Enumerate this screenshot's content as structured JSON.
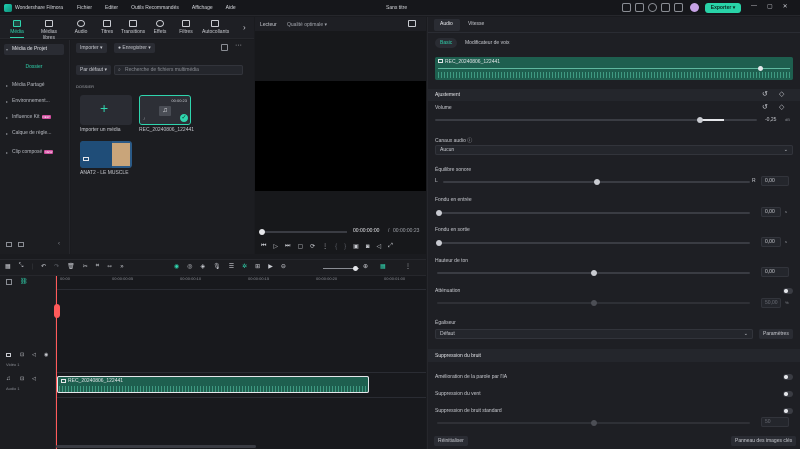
{
  "app": {
    "name": "Wondershare Filmora",
    "menu": [
      "Fichier",
      "Editer",
      "Outils Recommandés",
      "Affichage",
      "Aide"
    ],
    "document_title": "Sans titre",
    "export_label": "Exporter"
  },
  "left_tabs": [
    {
      "label": "Média",
      "icon": "media-icon"
    },
    {
      "label": "Médias libres",
      "icon": "stock-media-icon"
    },
    {
      "label": "Audio",
      "icon": "audio-icon"
    },
    {
      "label": "Titres",
      "icon": "titles-icon"
    },
    {
      "label": "Transitions",
      "icon": "transitions-icon"
    },
    {
      "label": "Effets",
      "icon": "effects-icon"
    },
    {
      "label": "Filtres",
      "icon": "filters-icon"
    },
    {
      "label": "Autocollants",
      "icon": "stickers-icon"
    }
  ],
  "sidebar": {
    "items": [
      {
        "label": "Média de Projet"
      },
      {
        "label": "Dossier"
      },
      {
        "label": "Média Partagé"
      },
      {
        "label": "Environnement..."
      },
      {
        "label": "Influence Kit",
        "badge": "NEW"
      },
      {
        "label": "Calque de règle..."
      },
      {
        "label": "Clip composé",
        "badge": "NEW"
      }
    ]
  },
  "media": {
    "import_label": "Importer",
    "record_label": "Enregistrer",
    "sort_label": "Par défaut",
    "search_placeholder": "Recherche de fichiers multimédia",
    "folder_label": "DOSSIER",
    "items": [
      {
        "label": "Importer un média",
        "type": "import"
      },
      {
        "label": "REC_20240806_122441",
        "type": "audio",
        "duration": "00:00:23",
        "selected": true
      },
      {
        "label": "ANAT2 - LE MUSCLE",
        "type": "video"
      }
    ]
  },
  "player": {
    "tab": "Lecteur",
    "quality": "Qualité optimale",
    "time_current": "00:00:00:00",
    "time_total": "00:00:00:23"
  },
  "right_panel": {
    "tabs": [
      "Audio",
      "Vitesse"
    ],
    "subtabs": [
      "Basic",
      "Modificateur de voix"
    ],
    "clip_name": "REC_20240806_122441",
    "section_adjust": "Ajustement",
    "volume_label": "Volume",
    "volume_value": "-0,25",
    "volume_unit": "dB",
    "audio_channel_label": "Canaux audio",
    "audio_channel_value": "Aucun",
    "balance_label": "Équilibre sonore",
    "balance_left": "L",
    "balance_right": "R",
    "balance_value": "0,00",
    "fade_in_label": "Fondu en entrée",
    "fade_in_value": "0,00",
    "fade_in_unit": "s",
    "fade_out_label": "Fondu en sortie",
    "fade_out_value": "0,00",
    "fade_out_unit": "s",
    "pitch_label": "Hauteur de ton",
    "pitch_value": "0,00",
    "ducking_label": "Atténuation",
    "ducking_value": "50,00",
    "ducking_unit": "%",
    "equalizer_label": "Égaliseur",
    "equalizer_value": "Défaut",
    "equalizer_settings": "Paramètres",
    "denoise_section": "Suppression du bruit",
    "denoise_items": [
      "Amélioration de la parole par l'IA",
      "Suppression du vent",
      "Suppression de bruit standard"
    ],
    "denoise_value": "50",
    "reset_label": "Réinitialiser",
    "keyframe_label": "Panneau des images clés"
  },
  "timeline": {
    "ruler": [
      "00:00",
      "00:00:00:05",
      "00:00:00:10",
      "00:00:00:15",
      "00:00:00:20",
      "00:00:01:00"
    ],
    "tracks": [
      {
        "label": "Vidéo 1",
        "type": "video"
      },
      {
        "label": "Audio 1",
        "type": "audio",
        "clip": "REC_20240806_122441"
      }
    ]
  },
  "colors": {
    "accent": "#2fd5ae",
    "clip_green": "#1e5f4f",
    "playhead": "#ff5a5a"
  }
}
